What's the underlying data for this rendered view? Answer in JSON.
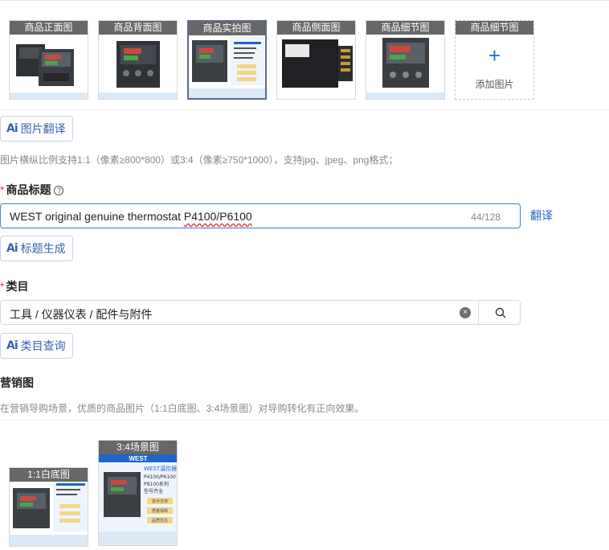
{
  "images": {
    "slots": [
      {
        "caption": "商品正面图",
        "selected": false
      },
      {
        "caption": "商品背面图",
        "selected": false
      },
      {
        "caption": "商品实拍图",
        "selected": true
      },
      {
        "caption": "商品侧面图",
        "selected": false
      },
      {
        "caption": "商品细节图",
        "selected": false
      }
    ],
    "add_slot": {
      "caption": "商品细节图",
      "plus": "+",
      "label": "添加图片"
    }
  },
  "image_translate": {
    "ai": "Ai",
    "label": "图片翻译"
  },
  "image_hint": "图片横纵比例支持1:1（像素≥800*800）或3:4（像素≥750*1000），支持jpg、jpeg、png格式；",
  "title_field": {
    "required_mark": "*",
    "label": "商品标题",
    "help": "?",
    "value_main": "WEST original genuine thermostat ",
    "value_flagged": "P4100/P6100",
    "count": "44/128",
    "translate": "翻译"
  },
  "title_gen": {
    "ai": "Ai",
    "label": "标题生成"
  },
  "category_field": {
    "required_mark": "*",
    "label": "类目",
    "value": "工具 / 仪器仪表 / 配件与附件",
    "clear": "×"
  },
  "category_query": {
    "ai": "Ai",
    "label": "类目查询"
  },
  "marketing": {
    "label": "营销图",
    "hint": "在营销导购场景，优质的商品图片（1:1白底图、3:4场景图）对导购转化有正向效果。",
    "square": {
      "caption": "1:1白底图"
    },
    "portrait": {
      "caption": "3:4场景图"
    }
  },
  "product_art": {
    "brand": "WEST温控器",
    "models": "P4100/P6100",
    "series": "P8100系列",
    "variants": "型号齐全",
    "tags": [
      "技术支持",
      "质量保障",
      "品质优先"
    ],
    "banner": "WEST"
  },
  "colors": {
    "accent": "#1f66c4",
    "required": "#e23b3b",
    "focus_border": "#4c86d6"
  }
}
